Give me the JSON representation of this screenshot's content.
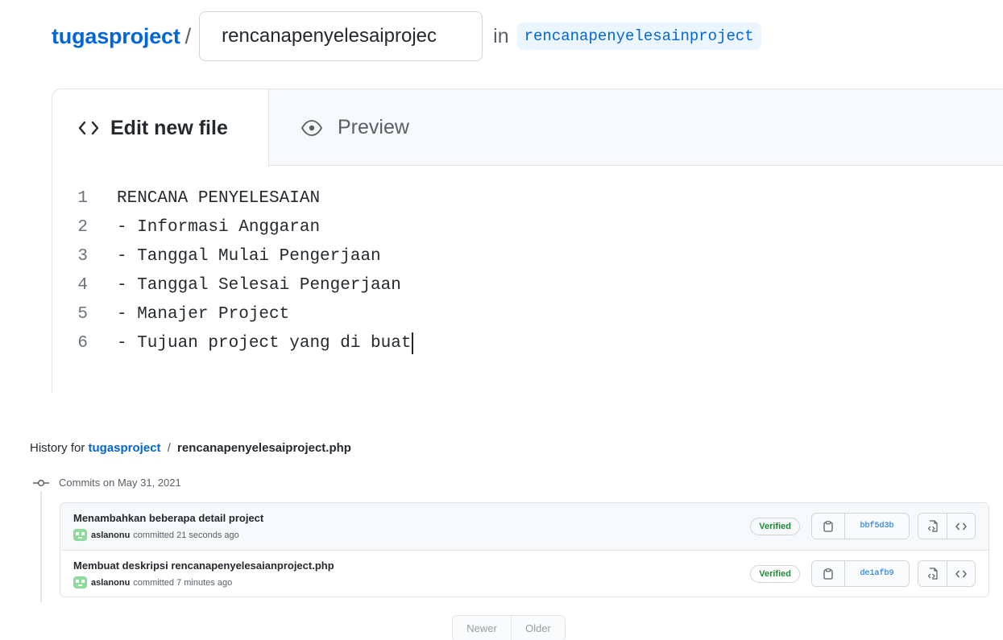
{
  "header": {
    "repo": "tugasproject",
    "separator": "/",
    "filename_value": "rencanapenyelesaiprojec",
    "in_label": "in",
    "branch": "rencanapenyelesainproject"
  },
  "editor": {
    "tabs": {
      "edit_label": "Edit new file",
      "preview_label": "Preview"
    },
    "lines": [
      {
        "num": "1",
        "text": "RENCANA PENYELESAIAN"
      },
      {
        "num": "2",
        "text": "- Informasi Anggaran"
      },
      {
        "num": "3",
        "text": "- Tanggal Mulai Pengerjaan"
      },
      {
        "num": "4",
        "text": "- Tanggal Selesai Pengerjaan"
      },
      {
        "num": "5",
        "text": "- Manajer Project"
      },
      {
        "num": "6",
        "text": "- Tujuan project yang di buat"
      }
    ]
  },
  "history": {
    "prefix": "History for",
    "repo": "tugasproject",
    "separator": "/",
    "file": "rencanapenyelesaiproject.php",
    "date_heading": "Commits on May 31, 2021",
    "commits": [
      {
        "message": "Menambahkan beberapa detail project",
        "author": "aslanonu",
        "time": "committed 21 seconds ago",
        "verified": "Verified",
        "sha": "bbf5d3b"
      },
      {
        "message": "Membuat deskripsi rencanapenyelesaianproject.php",
        "author": "aslanonu",
        "time": "committed 7 minutes ago",
        "verified": "Verified",
        "sha": "de1afb9"
      }
    ],
    "pagination": {
      "newer": "Newer",
      "older": "Older"
    }
  },
  "icons": {
    "code": "code-icon",
    "eye": "eye-icon",
    "commit": "git-commit-icon",
    "clipboard": "clipboard-icon",
    "file_code": "file-code-icon"
  },
  "colors": {
    "link": "#0366d6",
    "verified": "#22863a",
    "branch_bg": "#eaf5ff"
  }
}
